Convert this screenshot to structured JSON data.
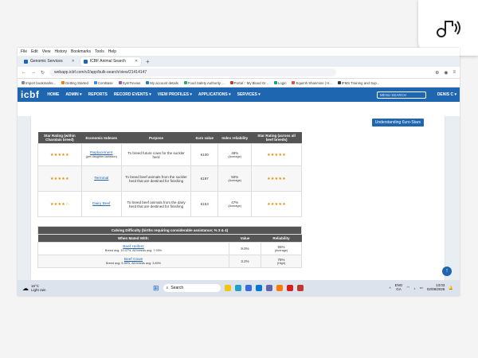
{
  "browser": {
    "menu": [
      "File",
      "Edit",
      "View",
      "History",
      "Bookmarks",
      "Tools",
      "Help"
    ],
    "tabs": [
      {
        "label": "Genomic Services"
      },
      {
        "label": "ICBF Animal Search"
      }
    ],
    "url": "webapp.icbf.com/v2/app/bulk-search/view/21414147",
    "bookmarks": [
      "Import bookmarks...",
      "Getting Started",
      "ComBase",
      "SymTrevius",
      "My account details",
      "Food Safety Authority ...",
      "Portal :: My Blood Gr...",
      "Login",
      "Equimh Shanmine | H...",
      "IFMS Training and Sup..."
    ]
  },
  "site": {
    "logo": "icbf",
    "nav": [
      "HOME",
      "ADMIN ▾",
      "REPORTS",
      "RECORD EVENTS ▾",
      "VIEW PROFILES ▾",
      "APPLICATIONS ▾",
      "SERVICES ▾"
    ],
    "search_placeholder": "MENU SEARCH",
    "user": "DENIS C ▾",
    "understanding_btn": "Understanding €uro-Stars"
  },
  "table1": {
    "headers": [
      "Star Rating (within Charolais breed)",
      "Economic Indexes",
      "Purpose",
      "€uro value",
      "Index reliability",
      "Star Rating (across all beef breeds)"
    ],
    "rows": [
      {
        "stars_within": "★★★★★",
        "index": "Replacement",
        "sub": "(per daughter lactation)",
        "purpose": "To breed future cows for the suckler herd",
        "value": "€100",
        "reliability": "48%",
        "rel_label": "(Average)",
        "stars_across": "★★★★★"
      },
      {
        "stars_within": "★★★★★",
        "index": "Terminal",
        "sub": "",
        "purpose": "To breed beef animals from the suckler herd that are destined for finishing",
        "value": "€197",
        "reliability": "50%",
        "rel_label": "(Average)",
        "stars_across": "★★★★★"
      },
      {
        "stars_within": "★★★★☆",
        "index": "Dairy Beef",
        "sub": "",
        "purpose": "To breed beef animals from the dairy herd that are destined for finishing",
        "value": "€153",
        "reliability": "47%",
        "rel_label": "(Average)",
        "stars_across": "★★★★★"
      }
    ]
  },
  "table2": {
    "title": "Calving Difficulty (births requiring considerable assistance; % 3 & 4)",
    "headers": [
      "When Mated With:",
      "Value",
      "Reliability"
    ],
    "rows": [
      {
        "label": "Beef Heifers",
        "avg": "Breed avg: 10.47%, All breeds avg: 7.93%",
        "value": "9.0%",
        "reliability": "55%",
        "rel_label": "(Average)"
      },
      {
        "label": "Beef Cows",
        "avg": "Breed avg: 5.55%, All breeds avg: 3.89%",
        "value": "3.2%",
        "reliability": "78%",
        "rel_label": "(High)"
      }
    ]
  },
  "taskbar": {
    "temp": "16°C",
    "weather": "Light rain",
    "search": "Search",
    "lang1": "ENG",
    "lang2": "GA",
    "time": "13:03",
    "date": "02/08/2026"
  }
}
